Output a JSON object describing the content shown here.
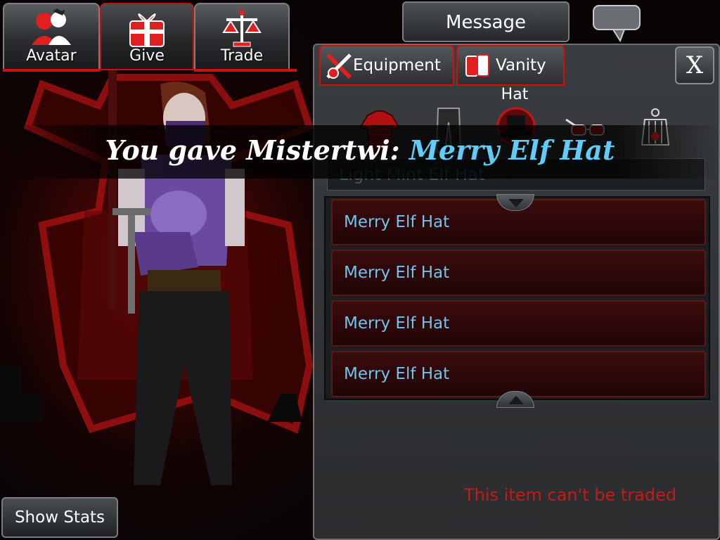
{
  "tabs": {
    "avatar": "Avatar",
    "give": "Give",
    "trade": "Trade"
  },
  "message_button": "Message",
  "sub_tabs": {
    "equipment": "Equipment",
    "vanity": "Vanity"
  },
  "close_label": "X",
  "slot_label": "Hat",
  "slots": [
    "shirt-icon",
    "pants-icon",
    "hat-icon",
    "glasses-icon",
    "lantern-icon"
  ],
  "search_value": "Light Mint Elf Hat",
  "items": [
    "Merry Elf Hat",
    "Merry Elf Hat",
    "Merry Elf Hat",
    "Merry Elf Hat"
  ],
  "trade_note": "This item can't be traded",
  "show_stats": "Show Stats",
  "notification": {
    "prefix": "You gave Mistertwi: ",
    "item": "Merry Elf Hat"
  },
  "colors": {
    "accent_red": "#d01010",
    "item_text": "#6ec6ef",
    "notice_item": "#5fcdf7",
    "warning": "#c51a1a"
  }
}
